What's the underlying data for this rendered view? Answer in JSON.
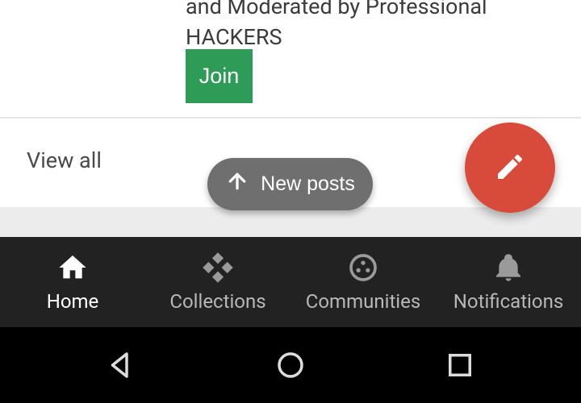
{
  "card": {
    "line1": "and Moderated by Professional",
    "line2": "HACKERS",
    "join_label": "Join"
  },
  "viewall": {
    "label": "View all"
  },
  "newposts": {
    "label": "New posts"
  },
  "tabs": {
    "home": "Home",
    "collections": "Collections",
    "communities": "Communities",
    "notifications": "Notifications"
  },
  "colors": {
    "accent_green": "#2e9c57",
    "fab_red": "#d84a3a",
    "pill_grey": "#6f6f6f",
    "tabbar_bg": "#222222"
  }
}
